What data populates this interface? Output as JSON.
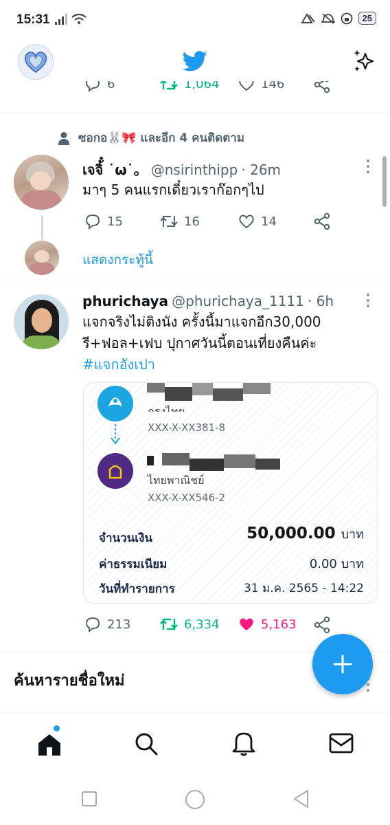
{
  "status_bar": {
    "time": "15:31",
    "battery": "25"
  },
  "header": {
    "logo_icon": "twitter-bird-icon",
    "avatar_icon": "heart-avatar",
    "sparkle_icon": "sparkle-icon"
  },
  "prev_tweet": {
    "replies": "6",
    "retweets": "1,064",
    "likes": "146"
  },
  "tweet1": {
    "social_context": "ซอกอ🐰🎀 และอีก 4 คนติดตาม",
    "name": "เจจิ้๋ ˙ω˙。",
    "handle": "@nsirinthipp",
    "time": "· 26m",
    "text": "มาๆ 5 คนแรกเดี๋ยวเราก๊อกๆไป",
    "replies": "15",
    "retweets": "16",
    "likes": "14",
    "show_thread": "แสดงกระทู้นี้"
  },
  "tweet2": {
    "name": "phurichaya",
    "handle": "@phurichaya_1111",
    "time": "· 6h",
    "text_line1": "แจกจริงไม่ติงนัง ครั้งนี้มาแจกอีก30,000",
    "text_line2": "รี+ฟอล+เฟบ ปุกาศวันนี้ตอนเที่ยงคืนค่ะ",
    "hashtag": "#แจกอังเปา",
    "replies": "213",
    "retweets": "6,334",
    "likes": "5,163",
    "retweet_color": "#00ba7c",
    "like_color": "#f91880",
    "slip": {
      "from_bank": "กรุงไทย",
      "from_account": "XXX-X-XX381-8",
      "to_bank": "ไทยพาณิชย์",
      "to_account": "XXX-X-XX546-2",
      "amount_label": "จำนวนเงิน",
      "amount_value": "50,000.00",
      "amount_unit": "บาท",
      "fee_label": "ค่าธรรมเนียม",
      "fee_value": "0.00 บาท",
      "date_label": "วันที่ทำรายการ",
      "date_value": "31 ม.ค. 2565 - 14:22"
    }
  },
  "who_to_follow": {
    "title": "ค้นหารายชื่อใหม่"
  },
  "colors": {
    "accent": "#1d9bf0"
  }
}
